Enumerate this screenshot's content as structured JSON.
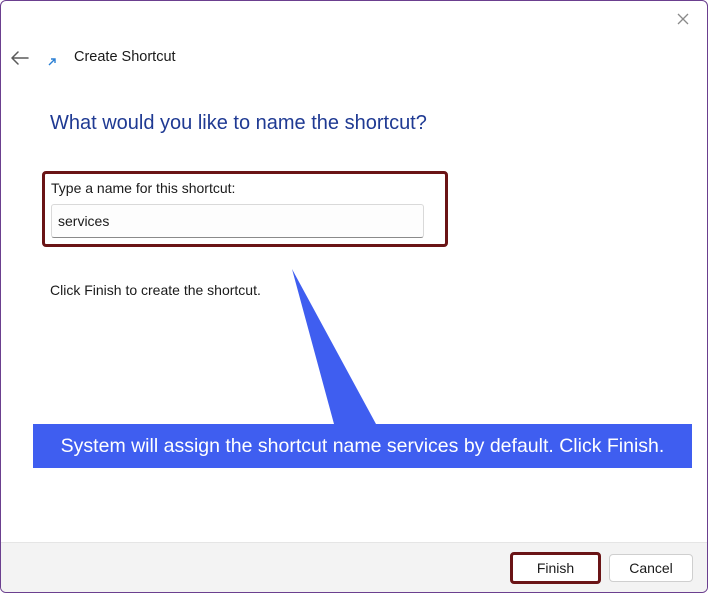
{
  "window": {
    "header_title": "Create Shortcut",
    "close_icon": "close-icon",
    "back_icon": "back-arrow-icon"
  },
  "main": {
    "question": "What would you like to name the shortcut?",
    "name_label": "Type a name for this shortcut:",
    "name_value": "services",
    "finish_hint": "Click Finish to create the shortcut."
  },
  "callout": {
    "text": "System will assign the shortcut name services by default. Click Finish.",
    "color": "#3f5ef0"
  },
  "footer": {
    "finish_label": "Finish",
    "cancel_label": "Cancel"
  },
  "colors": {
    "title_blue": "#1f3a93",
    "highlight_border": "#6a1416",
    "accent": "#3f5ef0"
  }
}
